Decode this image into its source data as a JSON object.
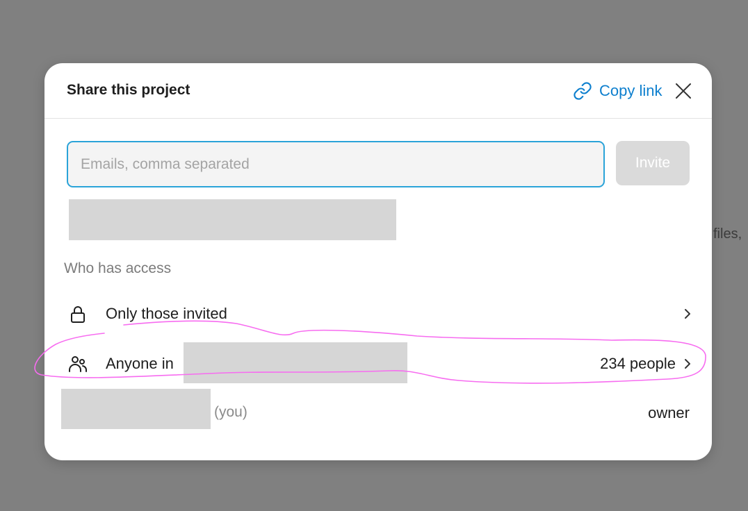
{
  "background": {
    "partial_text": "files,"
  },
  "modal": {
    "title": "Share this project",
    "copy_link_label": "Copy link",
    "email_input": {
      "placeholder": "Emails, comma separated",
      "value": ""
    },
    "invite_label": "Invite",
    "access_section_label": "Who has access",
    "rows": [
      {
        "label": "Only those invited",
        "icon": "lock-icon"
      },
      {
        "label": "Anyone in",
        "icon": "people-icon",
        "count": "234 people"
      }
    ],
    "owner_row": {
      "you_label": "(you)",
      "role": "owner"
    }
  },
  "colors": {
    "overlay": "#808080",
    "accent": "#0d7fce",
    "input_border": "#2aa3d8",
    "annotation": "#f76cf0",
    "redaction": "#d6d6d6"
  }
}
